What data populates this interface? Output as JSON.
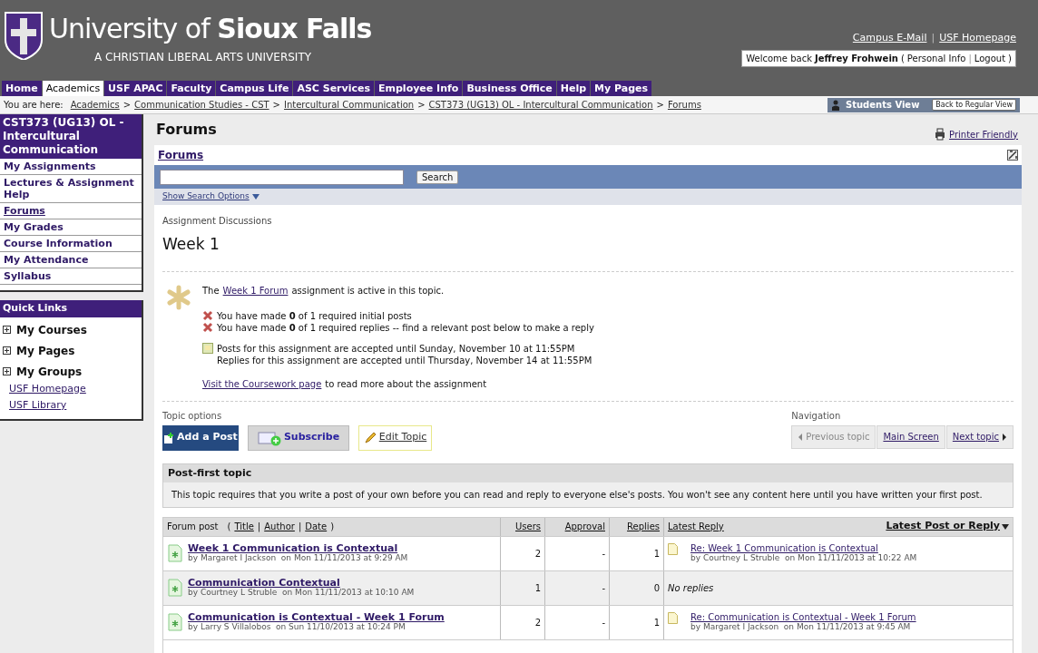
{
  "header": {
    "logo_title": "University of **Sioux Falls**",
    "tagline": "A CHRISTIAN LIBERAL ARTS UNIVERSITY",
    "top_links": [
      "Campus E-Mail",
      "USF Homepage"
    ],
    "link_separator": "|",
    "paren_open": "(",
    "paren_close": ")",
    "welcome_prefix": "Welcome back",
    "user_name": "Jeffrey Frohwein",
    "account_links": [
      "Personal Info",
      "Logout"
    ]
  },
  "nav_tabs": [
    {
      "label": "Home",
      "selected": false
    },
    {
      "label": "Academics",
      "selected": true
    },
    {
      "label": "USF APAC",
      "selected": false
    },
    {
      "label": "Faculty",
      "selected": false
    },
    {
      "label": "Campus Life",
      "selected": false
    },
    {
      "label": "ASC Services",
      "selected": false
    },
    {
      "label": "Employee Info",
      "selected": false
    },
    {
      "label": "Business Office",
      "selected": false
    },
    {
      "label": "Help",
      "selected": false
    },
    {
      "label": "My Pages",
      "selected": false
    }
  ],
  "breadcrumb": {
    "label": "You are here:",
    "separator": ">",
    "items": [
      "Academics",
      "Communication Studies - CST",
      "Intercultural Communication",
      "CST373 (UG13) OL - Intercultural Communication",
      "Forums"
    ]
  },
  "students_view": {
    "label": "Students View",
    "button": "Back to Regular View"
  },
  "sidebar": {
    "course_title": "CST373 (UG13) OL - Intercultural Communication",
    "items": [
      {
        "label": "My Assignments",
        "selected": false
      },
      {
        "label": "Lectures & Assignment Help",
        "selected": false
      },
      {
        "label": "Forums",
        "selected": true
      },
      {
        "label": "My Grades",
        "selected": false
      },
      {
        "label": "Course Information",
        "selected": false
      },
      {
        "label": "My Attendance",
        "selected": false
      },
      {
        "label": "Syllabus",
        "selected": false
      }
    ],
    "quick_links": {
      "title": "Quick Links",
      "groups": [
        {
          "label": "My Courses",
          "expanded": false
        },
        {
          "label": "My Pages",
          "expanded": false
        },
        {
          "label": "My Groups",
          "expanded": false
        }
      ],
      "links": [
        "USF Homepage",
        "USF Library"
      ]
    }
  },
  "main": {
    "page_title": "Forums",
    "printer_link": "Printer Friendly",
    "panel_title": "Forums",
    "search": {
      "button": "Search",
      "options_link": "Show Search Options"
    },
    "section_label": "Assignment Discussions",
    "topic_title": "Week 1",
    "assignment": {
      "before": "The",
      "link": "Week 1 Forum",
      "after": "assignment is active in this topic.",
      "requirements": [
        "You have made **0** of 1 required initial posts",
        "You have made **0** of 1 required replies -- find a relevant post below to make a reply"
      ],
      "deadlines": [
        "Posts for this assignment are accepted until Sunday, November 10 at 11:55PM",
        "Replies for this assignment are accepted until Thursday, November 14 at 11:55PM"
      ],
      "coursework_link": "Visit the Coursework page",
      "coursework_after": "to read more about the assignment"
    },
    "topic_options": {
      "label": "Topic options",
      "buttons": [
        {
          "kind": "add",
          "label": "Add a Post"
        },
        {
          "kind": "subscribe",
          "label": "Subscribe"
        },
        {
          "kind": "edit",
          "label": "Edit Topic"
        }
      ]
    },
    "navigation": {
      "label": "Navigation",
      "buttons": [
        {
          "kind": "prev",
          "label": "Previous topic",
          "disabled": true
        },
        {
          "kind": "main",
          "label": "Main Screen",
          "disabled": false
        },
        {
          "kind": "next",
          "label": "Next topic",
          "disabled": false
        }
      ]
    },
    "notice": {
      "title": "Post-first topic",
      "text": "This topic requires that you write a post of your own before you can read and reply to everyone else's posts. You won't see any content here until you have written your first post."
    },
    "table": {
      "first_column": "Forum post",
      "sort_links": [
        "Title",
        "Author",
        "Date"
      ],
      "sort_open": "(",
      "sort_separator": "|",
      "sort_close": ")",
      "columns": [
        "Users",
        "Approval",
        "Replies",
        "Latest Reply"
      ],
      "sort_label": "Latest Post or Reply",
      "rows": [
        {
          "title": "Week 1 Communication is Contextual",
          "byline": "by Margaret I Jackson  on Mon 11/11/2013 at 9:29 AM",
          "users": "2",
          "approval": "-",
          "replies": "1",
          "latest": {
            "title": "Re: Week 1 Communication is Contextual",
            "byline": "by Courtney L Struble  on Mon 11/11/2013 at 10:22 AM"
          }
        },
        {
          "title": "Communication Contextual",
          "byline": "by Courtney L Struble  on Mon 11/11/2013 at 10:10 AM",
          "users": "1",
          "approval": "-",
          "replies": "0",
          "no_reply": "No replies"
        },
        {
          "title": "Communication is Contextual - Week 1 Forum",
          "byline": "by Larry S Villalobos  on Sun 11/10/2013 at 10:24 PM",
          "users": "2",
          "approval": "-",
          "replies": "1",
          "latest": {
            "title": "Re: Communication is Contextual - Week 1 Forum",
            "byline": "by Margaret I Jackson  on Mon 11/11/2013 at 9:45 AM"
          }
        }
      ]
    }
  }
}
